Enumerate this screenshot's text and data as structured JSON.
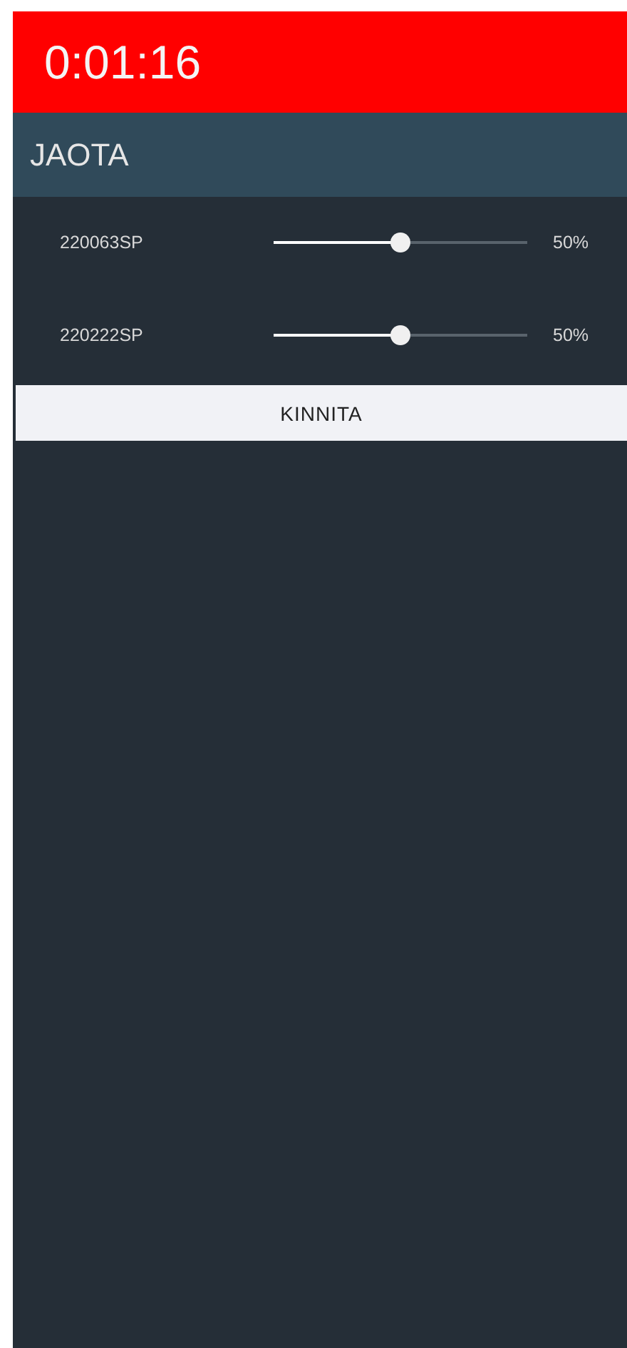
{
  "timer": "0:01:16",
  "title": "JAOTA",
  "sliders": [
    {
      "name": "220063SP",
      "level": 0.5,
      "reading": "50%"
    },
    {
      "name": "220222SP",
      "level": 0.5,
      "reading": "50%"
    }
  ],
  "confirm_button": "KINNITA"
}
